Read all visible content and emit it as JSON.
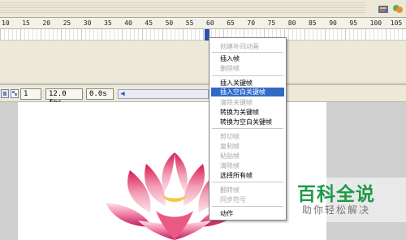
{
  "ruler": {
    "ticks": [
      "10",
      "15",
      "20",
      "25",
      "30",
      "35",
      "40",
      "45",
      "50",
      "55",
      "60",
      "65",
      "70",
      "75",
      "80",
      "85",
      "90",
      "95",
      "100",
      "105"
    ]
  },
  "status": {
    "frame": "1",
    "fps": "12.0 fps",
    "time": "0.0s"
  },
  "context_menu": {
    "items": [
      {
        "label": "创建补间动画",
        "enabled": false
      },
      {
        "label": "插入帧",
        "enabled": true
      },
      {
        "label": "删除帧",
        "enabled": false
      },
      {
        "label": "插入关键帧",
        "enabled": true
      },
      {
        "label": "插入空白关键帧",
        "enabled": true,
        "selected": true
      },
      {
        "label": "清除关键帧",
        "enabled": false
      },
      {
        "label": "转换为关键帧",
        "enabled": true
      },
      {
        "label": "转换为空白关键帧",
        "enabled": true
      },
      {
        "label": "剪切帧",
        "enabled": false
      },
      {
        "label": "复制帧",
        "enabled": false
      },
      {
        "label": "粘贴帧",
        "enabled": false
      },
      {
        "label": "清除帧",
        "enabled": false
      },
      {
        "label": "选择所有帧",
        "enabled": true
      },
      {
        "label": "翻转帧",
        "enabled": false
      },
      {
        "label": "同步符号",
        "enabled": false
      },
      {
        "label": "动作",
        "enabled": true
      }
    ]
  },
  "watermark": {
    "title": "百科全说",
    "subtitle": "助你轻松解决"
  },
  "colors": {
    "menu_highlight": "#316ac5",
    "playhead": "#2e4fb0",
    "watermark_green": "#1e9a4a"
  }
}
